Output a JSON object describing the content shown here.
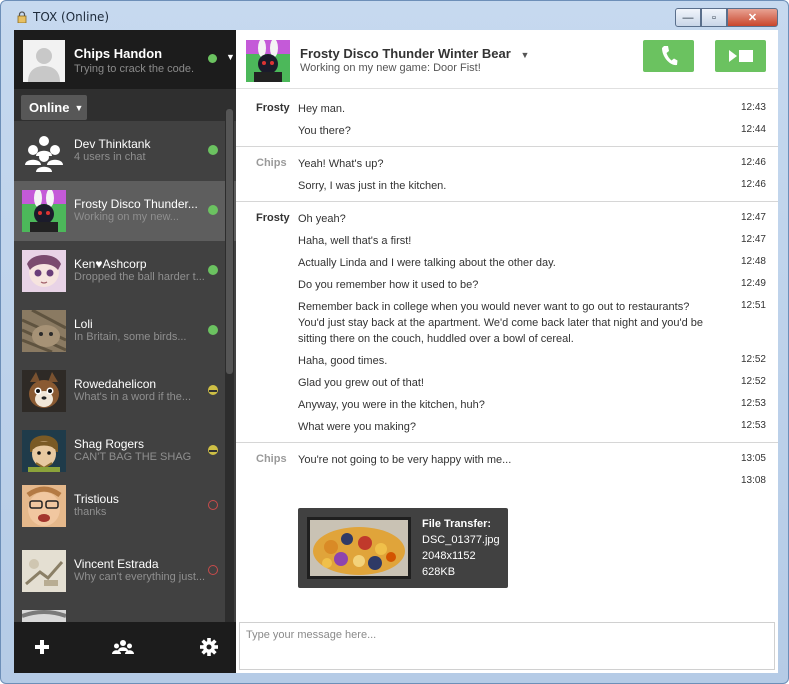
{
  "window": {
    "title": "TOX (Online)",
    "min_glyph": "—",
    "max_glyph": "▫",
    "close_glyph": "✕"
  },
  "self": {
    "name": "Chips Handon",
    "status_message": "Trying to crack the code.",
    "status": "online",
    "dropdown_glyph": "▼"
  },
  "filter": {
    "label": "Online",
    "arrow": "▼"
  },
  "friends": [
    {
      "name": "Dev Thinktank",
      "status_message": "4 users in chat",
      "status": "online",
      "avatar": "group-icon"
    },
    {
      "name": "Frosty Disco Thunder...",
      "status_message": "Working on my new...",
      "status": "online",
      "avatar": "frosty-avatar"
    },
    {
      "name": "Ken♥Ashcorp",
      "status_message": "Dropped the ball harder t...",
      "status": "online",
      "avatar": "ken-avatar"
    },
    {
      "name": "Loli",
      "status_message": "In Britain, some birds...",
      "status": "online",
      "avatar": "loli-avatar"
    },
    {
      "name": "Rowedahelicon",
      "status_message": "What's in a word if the...",
      "status": "away",
      "avatar": "rowedahelicon-avatar"
    },
    {
      "name": "Shag Rogers",
      "status_message": "CAN'T BAG THE SHAG",
      "status": "away",
      "avatar": "shag-avatar"
    },
    {
      "name": "Tristious",
      "status_message": "thanks",
      "status": "offline",
      "avatar": "tristious-avatar"
    },
    {
      "name": "Vincent Estrada",
      "status_message": "Why can't everything just...",
      "status": "offline",
      "avatar": "vincent-avatar"
    }
  ],
  "toolbar": {
    "add_icon": "plus-icon",
    "group_icon": "group-chat-icon",
    "settings_icon": "gear-icon"
  },
  "contact": {
    "name": "Frosty Disco Thunder Winter Bear",
    "name_arrow": "▼",
    "status_message": "Working on my new game: Door Fist!"
  },
  "messages": [
    {
      "author": "Frosty",
      "text": "Hey man.",
      "time": "12:43"
    },
    {
      "author": "",
      "text": "You there?",
      "time": "12:44"
    },
    {
      "author": "Chips",
      "text": "Yeah! What's up?",
      "time": "12:46"
    },
    {
      "author": "",
      "text": "Sorry, I was just in the kitchen.",
      "time": "12:46"
    },
    {
      "author": "Frosty",
      "text": "Oh yeah?",
      "time": "12:47"
    },
    {
      "author": "",
      "text": "Haha, well that's a first!",
      "time": "12:47"
    },
    {
      "author": "",
      "text": "Actually Linda and I were talking about the other day.",
      "time": "12:48"
    },
    {
      "author": "",
      "text": "Do you remember how it used to be?",
      "time": "12:49"
    },
    {
      "author": "",
      "text": "Remember back in college when you would never want to go out to restaurants? You'd just stay back at the apartment. We'd come back later that night and you'd be sitting there on the couch, huddled over a bowl of cereal.",
      "time": "12:51"
    },
    {
      "author": "",
      "text": "Haha, good times.",
      "time": "12:52"
    },
    {
      "author": "",
      "text": "Glad you grew out of that!",
      "time": "12:52"
    },
    {
      "author": "",
      "text": "Anyway, you were in the kitchen, huh?",
      "time": "12:53"
    },
    {
      "author": "",
      "text": "What were you making?",
      "time": "12:53"
    },
    {
      "author": "Chips",
      "text": "You're not going to be very happy with me...",
      "time": "13:05"
    },
    {
      "author": "",
      "text": "",
      "time": "13:08"
    }
  ],
  "file_transfer": {
    "label": "File Transfer:",
    "filename": "DSC_01377.jpg",
    "dimensions": "2048x1152",
    "size": "628KB"
  },
  "input": {
    "placeholder": "Type your message here..."
  },
  "colors": {
    "accent_green": "#6bc260",
    "away_yellow": "#cebf45",
    "offline_red": "#c84b4b",
    "sidebar_bg": "#414141",
    "panel_dark": "#1c1c1c"
  }
}
